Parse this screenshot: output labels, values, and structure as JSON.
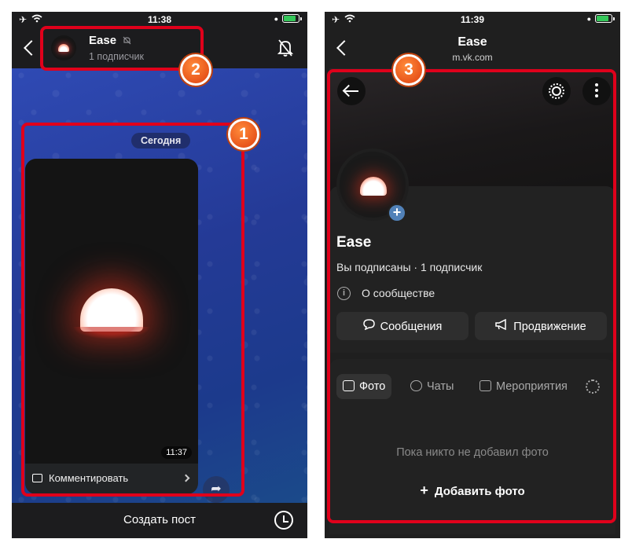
{
  "left_screen": {
    "status_time": "11:38",
    "channel_name": "Ease",
    "channel_subscribers": "1 подписчик",
    "date_divider": "Сегодня",
    "message_time": "11:37",
    "comment_label": "Комментировать",
    "footer_button": "Создать пост"
  },
  "right_screen": {
    "status_time": "11:39",
    "header_title": "Ease",
    "header_url": "m.vk.com",
    "community_name": "Ease",
    "subscription_status": "Вы подписаны · 1 подписчик",
    "about_link": "О сообществе",
    "buttons": {
      "messages": "Сообщения",
      "promotion": "Продвижение"
    },
    "tabs": [
      {
        "label": "Фото"
      },
      {
        "label": "Чаты"
      },
      {
        "label": "Мероприятия"
      }
    ],
    "empty_state": "Пока никто не добавил фото",
    "add_photo": "Добавить фото"
  },
  "annotations": {
    "badge_1": "1",
    "badge_2": "2",
    "badge_3": "3",
    "highlight_color": "#e0001b",
    "badge_color": "#e8551c"
  },
  "colors": {
    "vk_accent": "#5181b8",
    "battery_green": "#34c759"
  }
}
